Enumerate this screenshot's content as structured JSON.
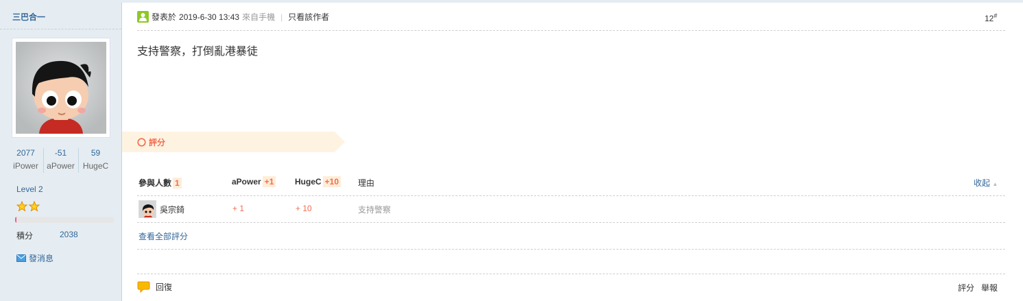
{
  "author": {
    "username": "三巴合一",
    "stats": [
      {
        "value": "2077",
        "label": "iPower"
      },
      {
        "value": "-51",
        "label": "aPower"
      },
      {
        "value": "59",
        "label": "HugeC"
      }
    ],
    "level": "Level 2",
    "level_progress": 0.01,
    "credits_label": "積分",
    "credits_value": "2038",
    "send_message": "發消息"
  },
  "post": {
    "posted_label": "發表於",
    "date": "2019-6-30 13:43",
    "from": "來自手機",
    "only_author": "只看該作者",
    "floor": "12",
    "floor_mark": "#",
    "content": "支持警察，打倒亂港暴徒"
  },
  "rating": {
    "title": "評分",
    "head_participants": "參與人數",
    "participants_count": "1",
    "head_apower": "aPower",
    "apower_total": "+1",
    "head_hugec": "HugeC",
    "hugec_total": "+10",
    "head_reason": "理由",
    "collapse": "收起",
    "rows": [
      {
        "user": "吳宗錡",
        "apower": "+ 1",
        "hugec": "+ 10",
        "reason": "支持警察"
      }
    ],
    "view_all": "查看全部評分"
  },
  "actions": {
    "reply": "回復",
    "rate": "評分",
    "report": "舉報"
  },
  "colors": {
    "sidebar_bg": "#e5edf2",
    "link": "#336699",
    "accent": "#f26c4f",
    "banner": "#fef3e1"
  }
}
